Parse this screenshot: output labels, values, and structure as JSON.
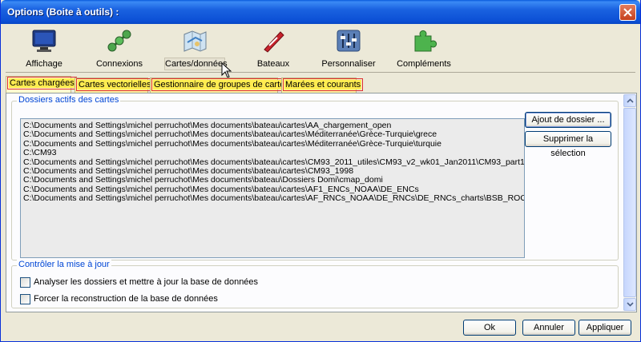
{
  "window": {
    "title": "Options (Boite à outils) :"
  },
  "toolbar": {
    "items": [
      {
        "label": "Affichage",
        "icon": "monitor-icon"
      },
      {
        "label": "Connexions",
        "icon": "connections-icon"
      },
      {
        "label": "Cartes/données",
        "icon": "charts-icon",
        "selected": true
      },
      {
        "label": "Bateaux",
        "icon": "boat-icon"
      },
      {
        "label": "Personnaliser",
        "icon": "sliders-icon"
      },
      {
        "label": "Compléments",
        "icon": "puzzle-icon"
      }
    ]
  },
  "tabs": [
    {
      "label": "Cartes chargées",
      "active": true
    },
    {
      "label": "Cartes vectorielles"
    },
    {
      "label": "Gestionnaire de groupes de cartes"
    },
    {
      "label": "Marées et courants"
    }
  ],
  "dossiers": {
    "legend": "Dossiers actifs des cartes",
    "items": [
      "C:\\Documents and Settings\\michel perruchot\\Mes documents\\bateau\\cartes\\AA_chargement_open",
      "C:\\Documents and Settings\\michel perruchot\\Mes documents\\bateau\\cartes\\Méditerranée\\Grèce-Turquie\\grece",
      "C:\\Documents and Settings\\michel perruchot\\Mes documents\\bateau\\cartes\\Méditerranée\\Grèce-Turquie\\turquie",
      "C:\\CM93",
      "C:\\Documents and Settings\\michel perruchot\\Mes documents\\bateau\\cartes\\CM93_2011_utiles\\CM93_v2_wk01_Jan2011\\CM93_part1",
      "C:\\Documents and Settings\\michel perruchot\\Mes documents\\bateau\\cartes\\CM93_1998",
      "C:\\Documents and Settings\\michel perruchot\\Mes documents\\bateau\\Dossiers Domi\\cmap_domi",
      "C:\\Documents and Settings\\michel perruchot\\Mes documents\\bateau\\cartes\\AF1_ENCs_NOAA\\DE_ENCs",
      "C:\\Documents and Settings\\michel perruchot\\Mes documents\\bateau\\cartes\\AF_RNCs_NOAA\\DE_RNCs\\DE_RNCs_charts\\BSB_ROOT"
    ],
    "add_label": "Ajout de dossier ...",
    "remove_label": "Supprimer la sélection"
  },
  "update": {
    "legend": "Contrôler la mise à jour",
    "scan_label": "Analyser les dossiers et mettre à jour la base de données",
    "scan_checked": false,
    "rebuild_label": "Forcer la reconstruction de la base de données",
    "rebuild_checked": false
  },
  "footer": {
    "ok": "Ok",
    "cancel": "Annuler",
    "apply": "Appliquer"
  }
}
